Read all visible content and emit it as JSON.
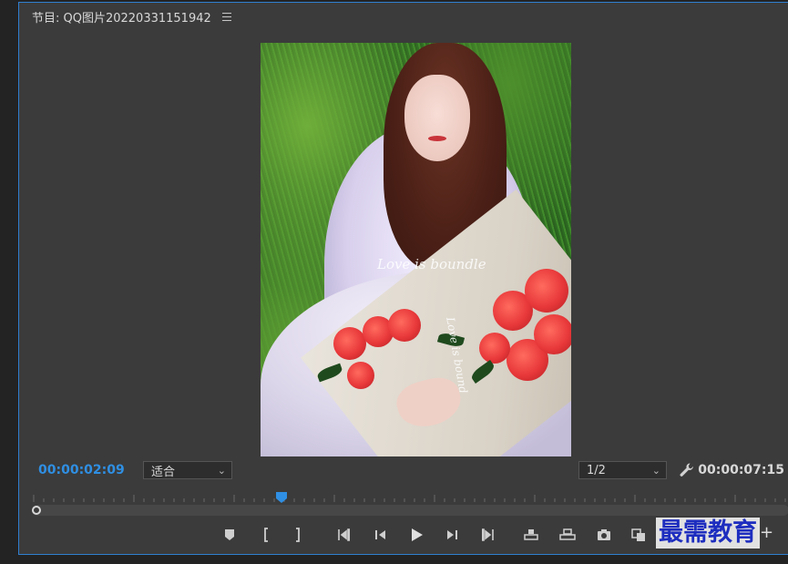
{
  "panel": {
    "title": "节目: QQ图片20220331151942"
  },
  "frame": {
    "overlay_text": "Love is boundle",
    "overlay_text2": "Love is bound"
  },
  "controls": {
    "current_timecode": "00:00:02:09",
    "duration_timecode": "00:00:07:15",
    "fit_select": {
      "value": "适合"
    },
    "resolution_select": {
      "value": "1/2"
    }
  },
  "playback": {
    "position_fraction": 0.33
  },
  "transport": {
    "buttons": [
      "add-marker",
      "mark-in",
      "mark-out",
      "go-to-in",
      "step-back",
      "play",
      "step-forward",
      "go-to-out",
      "lift",
      "extract",
      "export-frame",
      "compare-view"
    ]
  },
  "watermark": {
    "text": "最需教育"
  },
  "colors": {
    "accent_blue": "#2f8fe3",
    "panel_bg": "#3b3b3b",
    "panel_border": "#2f7fd1",
    "watermark_color": "#1d2dbf"
  }
}
